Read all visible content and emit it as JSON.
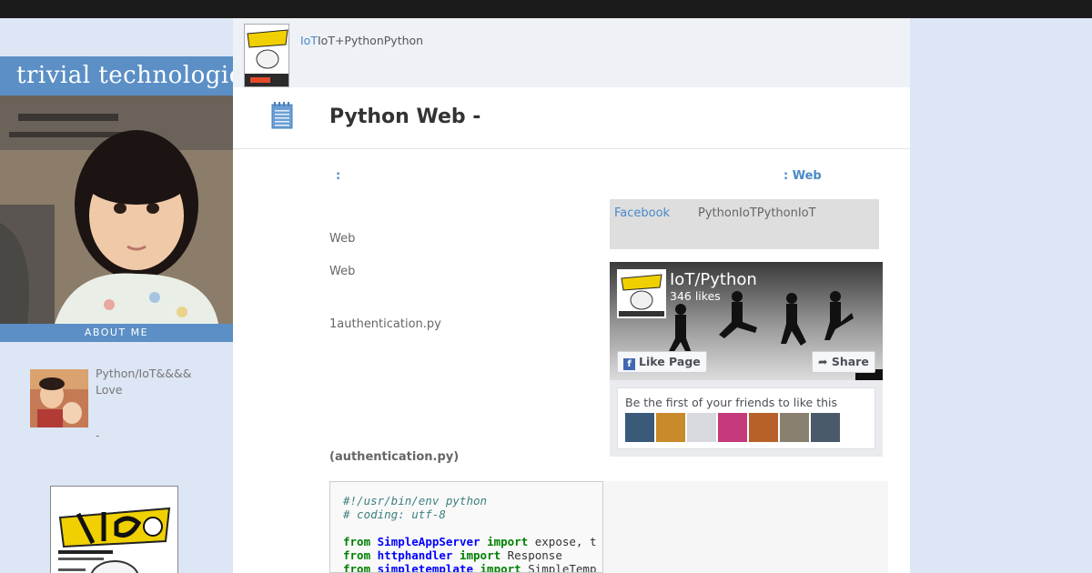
{
  "sidebar": {
    "site_title": "trivial technologies",
    "about_label": "ABOUT ME",
    "profile_text": "Python/IoT&&&& Love",
    "profile_dash": "-"
  },
  "header": {
    "link_text": "IoT",
    "title_text": "IoT+PythonPython"
  },
  "post": {
    "title": "Python Web -",
    "category_link": ":",
    "nav_link": ": Web",
    "para_web_1": "Web",
    "para_web_2": "Web",
    "file_text": "1authentication.py",
    "code_caption": "(authentication.py)"
  },
  "fb_notice": {
    "link": "Facebook",
    "text": "PythonIoTPythonIoT"
  },
  "fb_widget": {
    "page_name": "IoT/Python",
    "likes": "346 likes",
    "like_button": "Like Page",
    "share_button": "Share",
    "friends_text": "Be the first of your friends to like this"
  },
  "code": {
    "line1": "#!/usr/bin/env python",
    "line2": "# coding: utf-8",
    "kw_from": "from",
    "kw_import": "import",
    "mod1": "SimpleAppServer",
    "rest1": " expose, t",
    "mod2": "httphandler",
    "rest2": " Response",
    "mod3": "simpletemplate",
    "rest3": " SimpleTemp"
  },
  "colors": {
    "accent_blue": "#5b8fc6",
    "link_blue": "#4a8ac6",
    "page_bg": "#dce6f4"
  }
}
